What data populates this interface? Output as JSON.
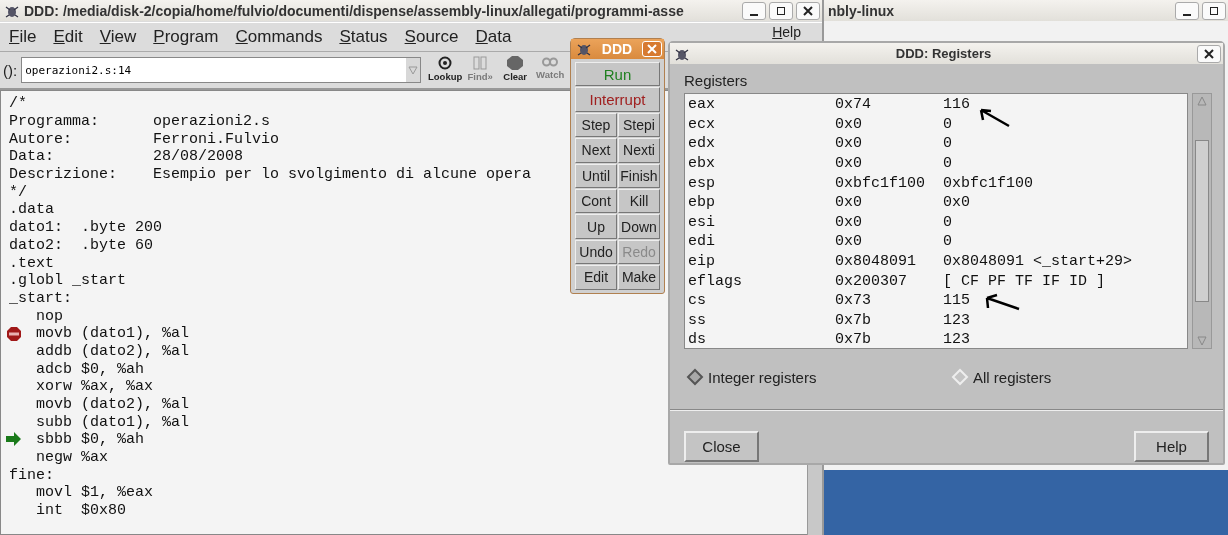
{
  "main_window": {
    "title": "DDD: /media/disk-2/copia/home/fulvio/documenti/dispense/assembly-linux/allegati/programmi-asse",
    "menu": [
      "File",
      "Edit",
      "View",
      "Program",
      "Commands",
      "Status",
      "Source",
      "Data",
      "Help"
    ],
    "toolbar": {
      "label": "():",
      "argument": "operazioni2.s:14",
      "buttons": [
        {
          "label": "Lookup",
          "kind": "lookup",
          "disabled": false
        },
        {
          "label": "Find»",
          "kind": "find",
          "disabled": true
        },
        {
          "label": "Clear",
          "kind": "clear",
          "disabled": false
        },
        {
          "label": "Watch",
          "kind": "watch",
          "disabled": true
        }
      ]
    },
    "source_lines": [
      {
        "text": "/*",
        "breakpoint": false,
        "current": false
      },
      {
        "text": "Programma:      operazioni2.s",
        "breakpoint": false,
        "current": false
      },
      {
        "text": "Autore:         Ferroni.Fulvio",
        "breakpoint": false,
        "current": false
      },
      {
        "text": "Data:           28/08/2008",
        "breakpoint": false,
        "current": false
      },
      {
        "text": "Descrizione:    Esempio per lo svolgimento di alcune opera",
        "breakpoint": false,
        "current": false
      },
      {
        "text": "*/",
        "breakpoint": false,
        "current": false
      },
      {
        "text": ".data",
        "breakpoint": false,
        "current": false
      },
      {
        "text": "dato1:  .byte 200",
        "breakpoint": false,
        "current": false
      },
      {
        "text": "dato2:  .byte 60",
        "breakpoint": false,
        "current": false
      },
      {
        "text": ".text",
        "breakpoint": false,
        "current": false
      },
      {
        "text": ".globl _start",
        "breakpoint": false,
        "current": false
      },
      {
        "text": "_start:",
        "breakpoint": false,
        "current": false
      },
      {
        "text": "   nop",
        "breakpoint": false,
        "current": false
      },
      {
        "text": "   movb (dato1), %al",
        "breakpoint": true,
        "current": false
      },
      {
        "text": "   addb (dato2), %al",
        "breakpoint": false,
        "current": false
      },
      {
        "text": "   adcb $0, %ah",
        "breakpoint": false,
        "current": false
      },
      {
        "text": "   xorw %ax, %ax",
        "breakpoint": false,
        "current": false
      },
      {
        "text": "   movb (dato2), %al",
        "breakpoint": false,
        "current": false
      },
      {
        "text": "   subb (dato1), %al",
        "breakpoint": false,
        "current": false
      },
      {
        "text": "   sbbb $0, %ah",
        "breakpoint": false,
        "current": true
      },
      {
        "text": "   negw %ax",
        "breakpoint": false,
        "current": false
      },
      {
        "text": "fine:",
        "breakpoint": false,
        "current": false
      },
      {
        "text": "   movl $1, %eax",
        "breakpoint": false,
        "current": false
      },
      {
        "text": "   int  $0x80",
        "breakpoint": false,
        "current": false
      }
    ]
  },
  "background_window": {
    "title": "nbly-linux"
  },
  "command_tool": {
    "title": "DDD",
    "buttons": [
      {
        "label": "Run",
        "kind": "run",
        "disabled": false
      },
      {
        "label": "Interrupt",
        "kind": "interrupt",
        "disabled": false
      },
      {
        "label": "Step",
        "kind": "plain",
        "disabled": false
      },
      {
        "label": "Stepi",
        "kind": "plain",
        "disabled": false
      },
      {
        "label": "Next",
        "kind": "plain",
        "disabled": false
      },
      {
        "label": "Nexti",
        "kind": "plain",
        "disabled": false
      },
      {
        "label": "Until",
        "kind": "plain",
        "disabled": false
      },
      {
        "label": "Finish",
        "kind": "plain",
        "disabled": false
      },
      {
        "label": "Cont",
        "kind": "plain",
        "disabled": false
      },
      {
        "label": "Kill",
        "kind": "plain",
        "disabled": false
      },
      {
        "label": "Up",
        "kind": "plain",
        "disabled": false
      },
      {
        "label": "Down",
        "kind": "plain",
        "disabled": false
      },
      {
        "label": "Undo",
        "kind": "plain",
        "disabled": false
      },
      {
        "label": "Redo",
        "kind": "plain",
        "disabled": true
      },
      {
        "label": "Edit",
        "kind": "plain",
        "disabled": false
      },
      {
        "label": "Make",
        "kind": "plain",
        "disabled": false
      }
    ]
  },
  "registers_dialog": {
    "title": "DDD: Registers",
    "label": "Registers",
    "rows": [
      {
        "name": "eax",
        "hex": "0x74",
        "value": "116"
      },
      {
        "name": "ecx",
        "hex": "0x0",
        "value": "0"
      },
      {
        "name": "edx",
        "hex": "0x0",
        "value": "0"
      },
      {
        "name": "ebx",
        "hex": "0x0",
        "value": "0"
      },
      {
        "name": "esp",
        "hex": "0xbfc1f100",
        "value": "0xbfc1f100"
      },
      {
        "name": "ebp",
        "hex": "0x0",
        "value": "0x0"
      },
      {
        "name": "esi",
        "hex": "0x0",
        "value": "0"
      },
      {
        "name": "edi",
        "hex": "0x0",
        "value": "0"
      },
      {
        "name": "eip",
        "hex": "0x8048091",
        "value": "0x8048091 <_start+29>"
      },
      {
        "name": "eflags",
        "hex": "0x200307",
        "value": "[ CF PF TF IF ID ]"
      },
      {
        "name": "cs",
        "hex": "0x73",
        "value": "115"
      },
      {
        "name": "ss",
        "hex": "0x7b",
        "value": "123"
      },
      {
        "name": "ds",
        "hex": "0x7b",
        "value": "123"
      }
    ],
    "options": [
      {
        "label": "Integer registers",
        "selected": true
      },
      {
        "label": "All registers",
        "selected": false
      }
    ],
    "buttons": [
      "Close",
      "Help"
    ]
  }
}
